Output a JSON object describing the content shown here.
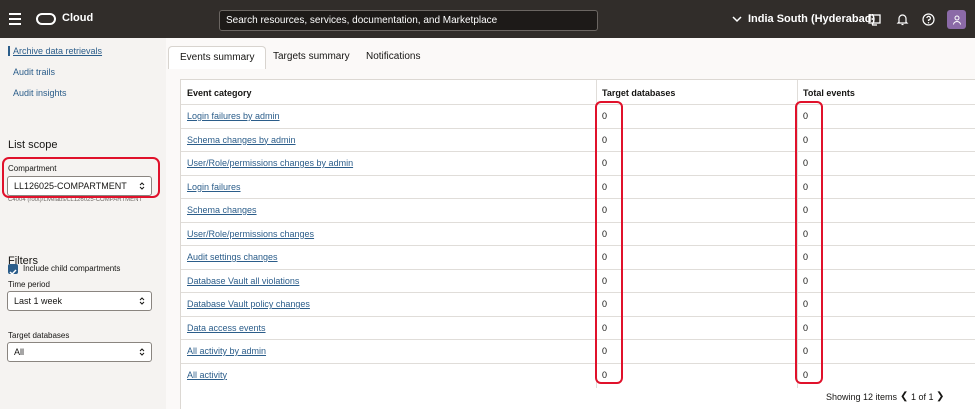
{
  "topbar": {
    "brand": "Cloud",
    "search_placeholder": "Search resources, services, documentation, and Marketplace",
    "region": "India South (Hyderabad)"
  },
  "sidebar": {
    "links": [
      "Archive data retrievals",
      "Audit trails",
      "Audit insights"
    ],
    "list_scope_heading": "List scope",
    "compartment_label": "Compartment",
    "compartment_value": "LL126025-COMPARTMENT",
    "compartment_path": "C4004 (root)/Livelabs/LL126025-COMPARTMENT",
    "include_child_label": "Include child compartments",
    "filters_heading": "Filters",
    "time_period_label": "Time period",
    "time_period_value": "Last 1 week",
    "target_databases_label": "Target databases",
    "target_databases_value": "All"
  },
  "tabs": [
    "Events summary",
    "Targets summary",
    "Notifications"
  ],
  "table": {
    "headers": [
      "Event category",
      "Target databases",
      "Total events"
    ],
    "rows": [
      {
        "category": "Login failures by admin",
        "targets": "0",
        "events": "0"
      },
      {
        "category": "Schema changes by admin",
        "targets": "0",
        "events": "0"
      },
      {
        "category": "User/Role/permissions changes by admin",
        "targets": "0",
        "events": "0"
      },
      {
        "category": "Login failures",
        "targets": "0",
        "events": "0"
      },
      {
        "category": "Schema changes",
        "targets": "0",
        "events": "0"
      },
      {
        "category": "User/Role/permissions changes",
        "targets": "0",
        "events": "0"
      },
      {
        "category": "Audit settings changes",
        "targets": "0",
        "events": "0"
      },
      {
        "category": "Database Vault all violations",
        "targets": "0",
        "events": "0"
      },
      {
        "category": "Database Vault policy changes",
        "targets": "0",
        "events": "0"
      },
      {
        "category": "Data access events",
        "targets": "0",
        "events": "0"
      },
      {
        "category": "All activity by admin",
        "targets": "0",
        "events": "0"
      },
      {
        "category": "All activity",
        "targets": "0",
        "events": "0"
      }
    ]
  },
  "footer": {
    "showing": "Showing 12 items",
    "page": "1 of 1",
    "prev": "❮",
    "next": "❯"
  },
  "colors": {
    "topbar": "#312d2a",
    "link": "#2b5d8a",
    "highlight": "#e0112b",
    "avatar": "#8b6aa7"
  }
}
